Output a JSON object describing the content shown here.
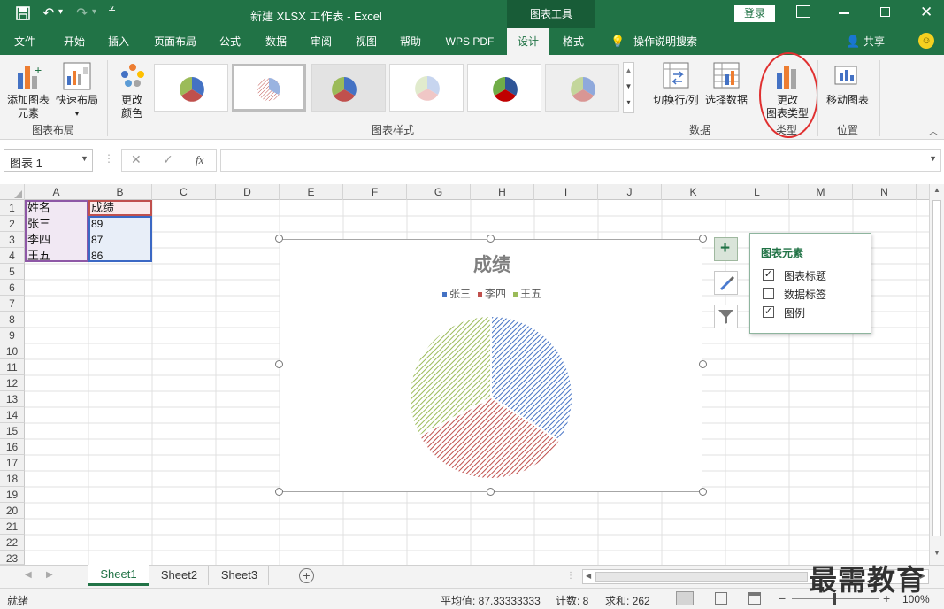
{
  "window": {
    "title": "新建 XLSX 工作表 - Excel",
    "context_tab": "图表工具",
    "login_button": "登录"
  },
  "tabs": [
    "文件",
    "开始",
    "插入",
    "页面布局",
    "公式",
    "数据",
    "审阅",
    "视图",
    "帮助",
    "WPS PDF",
    "设计",
    "格式"
  ],
  "active_tab": "设计",
  "tell_me": "操作说明搜索",
  "share": "共享",
  "ribbon": {
    "add_element": [
      "添加图表",
      "元素"
    ],
    "quick_layout": "快速布局",
    "change_color": [
      "更改",
      "颜色"
    ],
    "group_layout": "图表布局",
    "group_styles": "图表样式",
    "switch_row_col": "切换行/列",
    "select_data": "选择数据",
    "group_data": "数据",
    "change_type": [
      "更改",
      "图表类型"
    ],
    "group_type": "类型",
    "move_chart": "移动图表",
    "group_location": "位置"
  },
  "formula_bar": {
    "name_box": "图表 1",
    "fx": "fx",
    "value": ""
  },
  "columns": [
    "A",
    "B",
    "C",
    "D",
    "E",
    "F",
    "G",
    "H",
    "I",
    "J",
    "K",
    "L",
    "M",
    "N"
  ],
  "rows": [
    "1",
    "2",
    "3",
    "4",
    "5",
    "6",
    "7",
    "8",
    "9",
    "10",
    "11",
    "12",
    "13",
    "14",
    "15",
    "16",
    "17",
    "18",
    "19",
    "20",
    "21",
    "22",
    "23"
  ],
  "cells": {
    "A1": "姓名",
    "B1": "成绩",
    "A2": "张三",
    "B2": "89",
    "A3": "李四",
    "B3": "87",
    "A4": "王五",
    "B4": "86"
  },
  "chart_data": {
    "type": "pie",
    "title": "成绩",
    "categories": [
      "张三",
      "李四",
      "王五"
    ],
    "values": [
      89,
      87,
      86
    ],
    "colors": [
      "#4472c4",
      "#c0504d",
      "#9bbb59"
    ],
    "legend_position": "top",
    "fill_pattern": "diagonal-stripes"
  },
  "chart_elements_panel": {
    "title": "图表元素",
    "items": [
      {
        "label": "图表标题",
        "checked": true
      },
      {
        "label": "数据标签",
        "checked": false
      },
      {
        "label": "图例",
        "checked": true
      }
    ]
  },
  "sheets": [
    "Sheet1",
    "Sheet2",
    "Sheet3"
  ],
  "active_sheet": "Sheet1",
  "status": {
    "ready": "就绪",
    "average": "平均值: 87.33333333",
    "count": "计数: 8",
    "sum": "求和: 262",
    "zoom": "100%"
  },
  "watermark": "最需教育"
}
